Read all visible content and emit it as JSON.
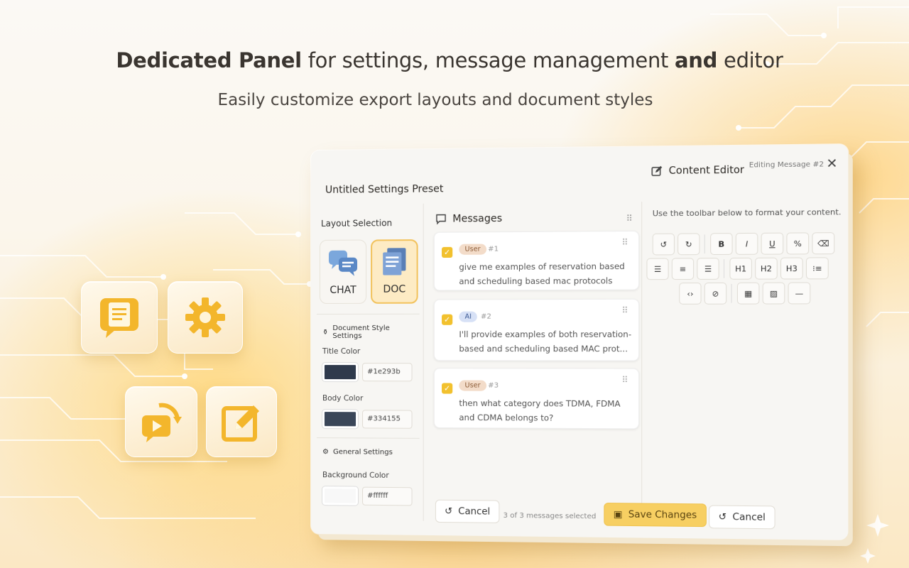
{
  "headline": {
    "bold": "Dedicated Panel",
    "rest": " for settings, message management ",
    "and": "and",
    "editor": " editor"
  },
  "subline": "Easily customize export layouts and document styles",
  "window": {
    "preset_title": "Untitled Settings Preset",
    "editor_title": "Content Editor",
    "editing_message": "Editing Message #2",
    "close_icon": "close-icon"
  },
  "left_panel": {
    "layout_label": "Layout Selection",
    "layouts": [
      {
        "label": "CHAT",
        "icon": "chat-bubbles-icon",
        "active": false
      },
      {
        "label": "DOC",
        "icon": "document-icon",
        "active": true
      }
    ],
    "doc_style": {
      "title": "Document Style Settings",
      "title_color_label": "Title Color",
      "title_color": "#1e293b",
      "body_color_label": "Body Color",
      "body_color": "#334155"
    },
    "general": {
      "title": "General Settings",
      "bg_color_label": "Background Color",
      "bg_color": "#ffffff"
    }
  },
  "messages": {
    "title": "Messages",
    "items": [
      {
        "role": "User",
        "num": "#1",
        "text": "give me examples of reservation based and scheduling based mac protocols",
        "checked": true
      },
      {
        "role": "AI",
        "num": "#2",
        "text": "I'll provide examples of both reservation-based and scheduling based MAC prot...",
        "checked": true
      },
      {
        "role": "User",
        "num": "#3",
        "text": "then what category does TDMA, FDMA and CDMA belongs to?",
        "checked": true
      }
    ]
  },
  "editor": {
    "hint": "Use the toolbar below to format your content.",
    "toolbar_row1": [
      "undo-icon",
      "redo-icon",
      "B",
      "I",
      "U",
      "%",
      "clear-format-icon"
    ],
    "toolbar_row2": [
      "align-left-icon",
      "align-center-icon",
      "align-right-icon",
      "H1",
      "H2",
      "H3",
      "list-icon"
    ],
    "toolbar_row3": [
      "code-icon",
      "link-icon",
      "table-icon",
      "image-icon",
      "horizontal-rule-icon"
    ]
  },
  "footer": {
    "cancel_left": "Cancel",
    "selected_count": "3 of 3 messages selected",
    "save": "Save Changes",
    "cancel_right": "Cancel"
  },
  "colors": {
    "accent": "#f7cf62",
    "title_swatch": "#1e293b",
    "body_swatch": "#334155",
    "bg_swatch": "#ffffff"
  }
}
